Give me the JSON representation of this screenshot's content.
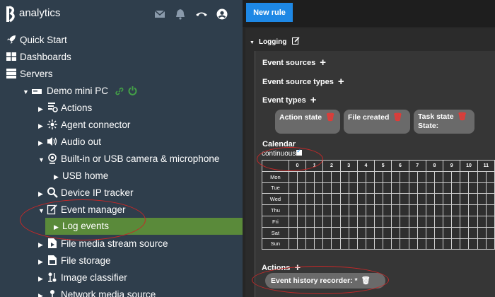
{
  "app": {
    "brand": "analytics"
  },
  "colors": {
    "sidebar_bg": "#2f3e4c",
    "selected_bg": "#5a8a3a",
    "primary": "#1e88e5",
    "online": "#43a047",
    "delete": "#e53935",
    "annotation": "#c62828"
  },
  "topbar_icons": [
    "mail-icon",
    "bell-icon",
    "phone-icon",
    "user-icon"
  ],
  "sidebar": {
    "quick_start": "Quick Start",
    "dashboards": "Dashboards",
    "servers": "Servers",
    "demo_pc": "Demo mini PC",
    "items": [
      "Actions",
      "Agent connector",
      "Audio out",
      "Built-in or USB camera & microphone",
      "USB home",
      "Device IP tracker",
      "Event manager",
      "Log events",
      "File media stream source",
      "File storage",
      "Image classifier",
      "Network media source"
    ]
  },
  "toolbar": {
    "new_rule": "New rule"
  },
  "logging": {
    "title": "Logging",
    "event_sources": "Event sources",
    "event_source_types": "Event source types",
    "event_types": "Event types",
    "chips": {
      "action_state": "Action state",
      "file_created": "File created",
      "task_state": "Task state",
      "task_state_sub": "State:"
    },
    "calendar": "Calendar",
    "continuous": "continuous",
    "hours": [
      "0",
      "1",
      "2",
      "3",
      "4",
      "5",
      "6",
      "7",
      "8",
      "9",
      "10",
      "11"
    ],
    "days": [
      "Mon",
      "Tue",
      "Wed",
      "Thu",
      "Fri",
      "Sat",
      "Sun"
    ],
    "actions": "Actions",
    "recorder": "Event history recorder: *"
  }
}
